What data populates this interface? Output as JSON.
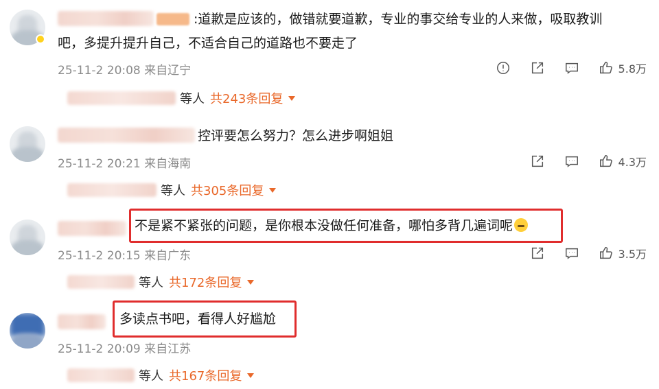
{
  "comments": [
    {
      "text_line1": ":道歉是应该的，做错就要道歉，专业的事交给专业的人来做，吸取教训",
      "text_line2": "吧，多提升提升自己，不适合自己的道路也不要走了",
      "time": "25-11-2 20:08 来自辽宁",
      "likes": "5.8万",
      "replies_wait": "等人",
      "replies_total": "共243条回复",
      "has_report": true,
      "fan_badge": true
    },
    {
      "text_line1": "控评要怎么努力？怎么进步啊姐姐",
      "time": "25-11-2 20:21 来自海南",
      "likes": "4.3万",
      "replies_wait": "等人",
      "replies_total": "共305条回复",
      "has_report": false
    },
    {
      "text_line1": "不是紧不紧张的问题，是你根本没做任何准备，哪怕多背几遍词呢",
      "time": "25-11-2 20:15 来自广东",
      "likes": "3.5万",
      "replies_wait": "等人",
      "replies_total": "共172条回复",
      "highlighted": true,
      "emoji": "sweat-smile-emoji"
    },
    {
      "text_line1": "多读点书吧，看得人好尴尬",
      "time": "25-11-2 20:09 来自江苏",
      "replies_wait": "等人",
      "replies_total": "共167条回复",
      "highlighted": true
    }
  ],
  "icons": {
    "report": "report-icon",
    "share": "share-icon",
    "comment": "comment-icon",
    "like": "thumbs-up-icon",
    "expand": "caret-down-icon"
  },
  "colors": {
    "highlight_border": "#e02d2d",
    "reply_count": "#e9682a",
    "meta_text": "#8a8a8a"
  }
}
